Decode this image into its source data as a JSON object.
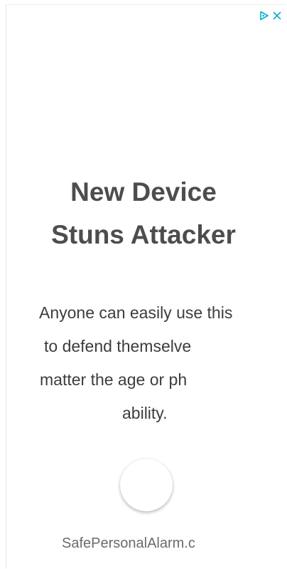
{
  "ad": {
    "adchoices": {
      "icon": "adchoices-triangle-icon",
      "close_icon": "close-x-icon",
      "accent_color": "#00aecd"
    },
    "headline": {
      "line1": "New Device",
      "line2": "Stuns Attacker"
    },
    "body": {
      "line1": "Anyone can easily use this",
      "line2": "to defend themselve",
      "line3": "matter the age or ph",
      "line4": "ability."
    },
    "cta": {
      "icon": "cta-circle-button"
    },
    "domain": "SafePersonalAlarm.c"
  }
}
